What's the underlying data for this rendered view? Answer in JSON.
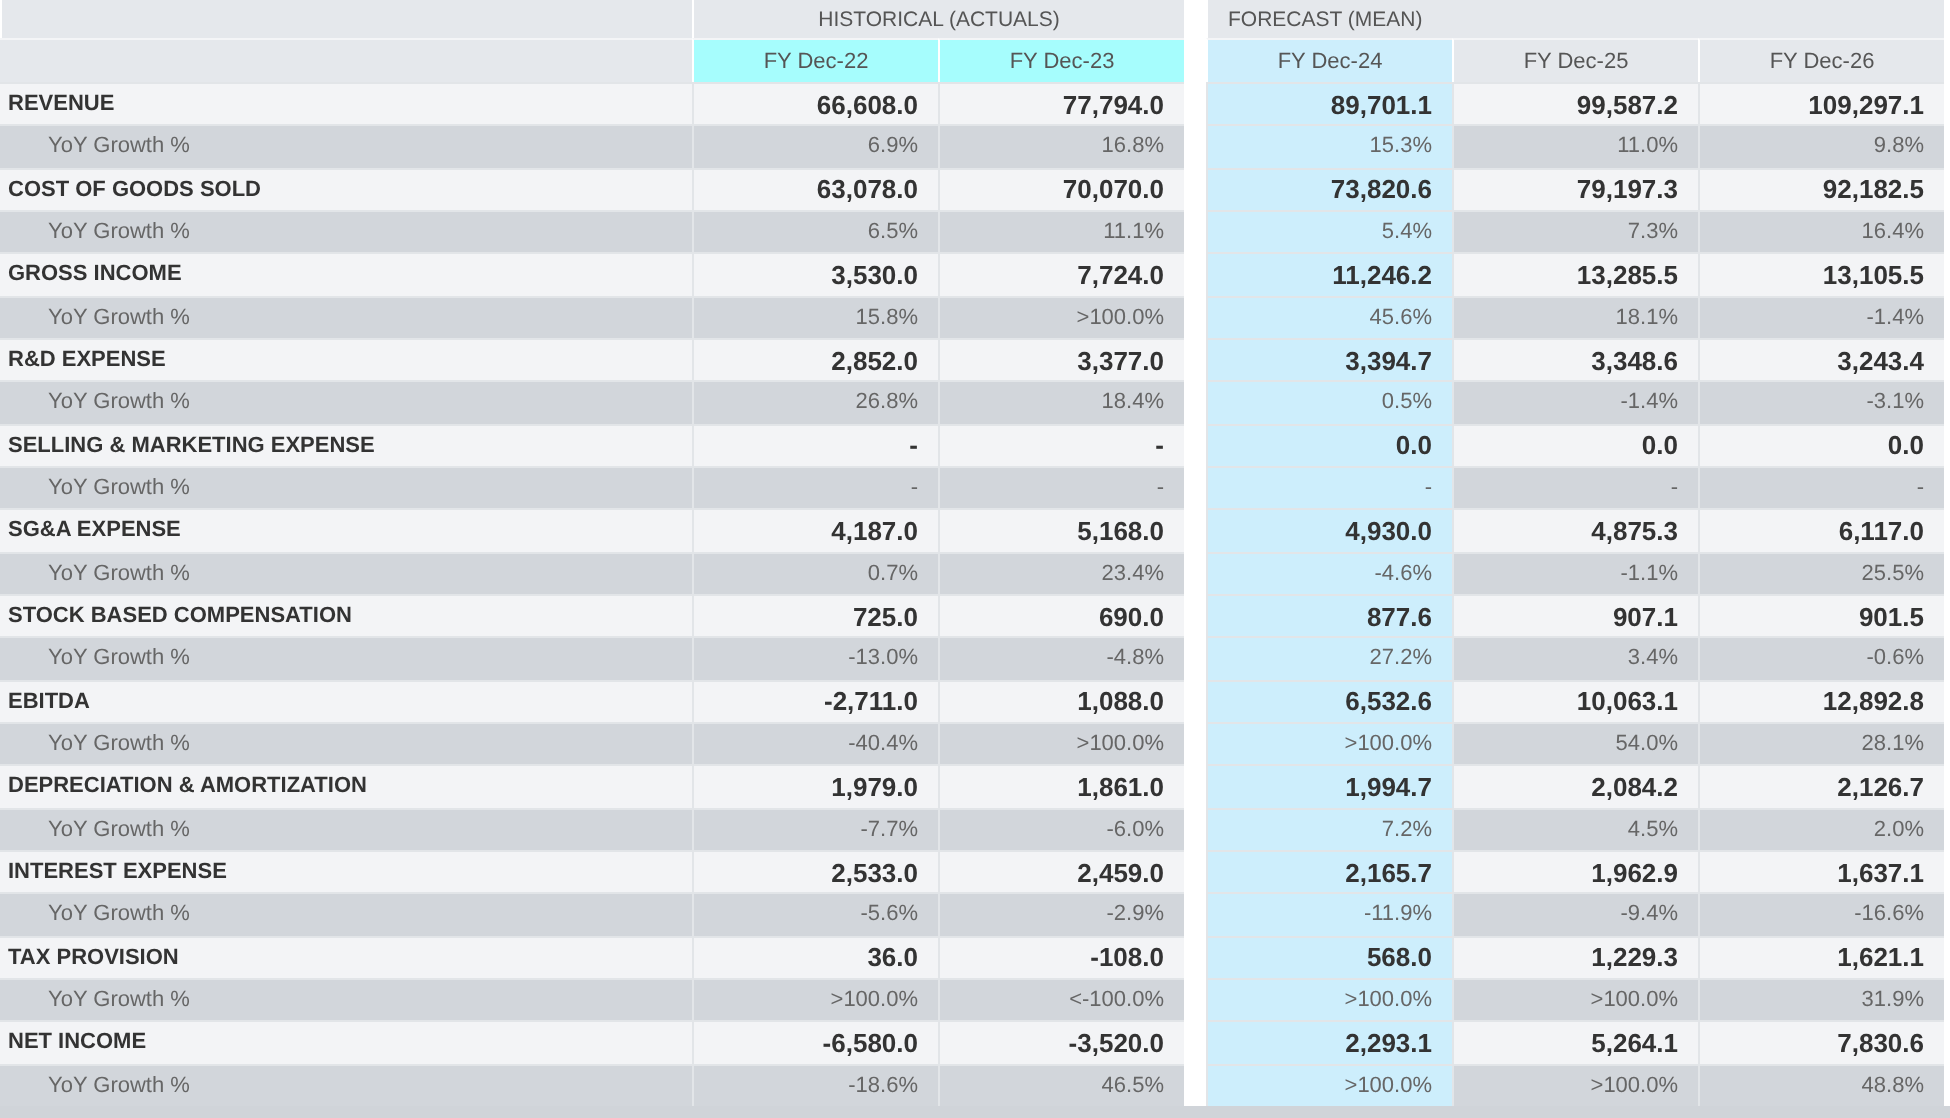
{
  "groups": [
    {
      "label": "HISTORICAL (ACTUALS)",
      "columns": [
        {
          "label": "FY Dec-22",
          "highlighted": true,
          "selected": false
        },
        {
          "label": "FY Dec-23",
          "highlighted": true,
          "selected": false
        }
      ]
    },
    {
      "label": "FORECAST (MEAN)",
      "columns": [
        {
          "label": "FY Dec-24",
          "highlighted": false,
          "selected": true
        },
        {
          "label": "FY Dec-25",
          "highlighted": false,
          "selected": false
        },
        {
          "label": "FY Dec-26",
          "highlighted": false,
          "selected": false
        }
      ]
    }
  ],
  "rows": [
    {
      "kind": "metric",
      "label": "REVENUE",
      "values": [
        "66,608.0",
        "77,794.0",
        "89,701.1",
        "99,587.2",
        "109,297.1"
      ]
    },
    {
      "kind": "growth",
      "label": "YoY Growth %",
      "values": [
        "6.9%",
        "16.8%",
        "15.3%",
        "11.0%",
        "9.8%"
      ]
    },
    {
      "kind": "metric",
      "label": "COST OF GOODS SOLD",
      "values": [
        "63,078.0",
        "70,070.0",
        "73,820.6",
        "79,197.3",
        "92,182.5"
      ]
    },
    {
      "kind": "growth",
      "label": "YoY Growth %",
      "values": [
        "6.5%",
        "11.1%",
        "5.4%",
        "7.3%",
        "16.4%"
      ]
    },
    {
      "kind": "metric",
      "label": "GROSS INCOME",
      "values": [
        "3,530.0",
        "7,724.0",
        "11,246.2",
        "13,285.5",
        "13,105.5"
      ]
    },
    {
      "kind": "growth",
      "label": "YoY Growth %",
      "values": [
        "15.8%",
        ">100.0%",
        "45.6%",
        "18.1%",
        "-1.4%"
      ]
    },
    {
      "kind": "metric",
      "label": "R&D EXPENSE",
      "values": [
        "2,852.0",
        "3,377.0",
        "3,394.7",
        "3,348.6",
        "3,243.4"
      ]
    },
    {
      "kind": "growth",
      "label": "YoY Growth %",
      "values": [
        "26.8%",
        "18.4%",
        "0.5%",
        "-1.4%",
        "-3.1%"
      ]
    },
    {
      "kind": "metric",
      "label": "SELLING & MARKETING EXPENSE",
      "values": [
        "-",
        "-",
        "0.0",
        "0.0",
        "0.0"
      ]
    },
    {
      "kind": "growth",
      "label": "YoY Growth %",
      "values": [
        "-",
        "-",
        "-",
        "-",
        "-"
      ]
    },
    {
      "kind": "metric",
      "label": "SG&A EXPENSE",
      "values": [
        "4,187.0",
        "5,168.0",
        "4,930.0",
        "4,875.3",
        "6,117.0"
      ]
    },
    {
      "kind": "growth",
      "label": "YoY Growth %",
      "values": [
        "0.7%",
        "23.4%",
        "-4.6%",
        "-1.1%",
        "25.5%"
      ]
    },
    {
      "kind": "metric",
      "label": "STOCK BASED COMPENSATION",
      "values": [
        "725.0",
        "690.0",
        "877.6",
        "907.1",
        "901.5"
      ]
    },
    {
      "kind": "growth",
      "label": "YoY Growth %",
      "values": [
        "-13.0%",
        "-4.8%",
        "27.2%",
        "3.4%",
        "-0.6%"
      ]
    },
    {
      "kind": "metric",
      "label": "EBITDA",
      "values": [
        "-2,711.0",
        "1,088.0",
        "6,532.6",
        "10,063.1",
        "12,892.8"
      ]
    },
    {
      "kind": "growth",
      "label": "YoY Growth %",
      "values": [
        "-40.4%",
        ">100.0%",
        ">100.0%",
        "54.0%",
        "28.1%"
      ]
    },
    {
      "kind": "metric",
      "label": "DEPRECIATION & AMORTIZATION",
      "values": [
        "1,979.0",
        "1,861.0",
        "1,994.7",
        "2,084.2",
        "2,126.7"
      ]
    },
    {
      "kind": "growth",
      "label": "YoY Growth %",
      "values": [
        "-7.7%",
        "-6.0%",
        "7.2%",
        "4.5%",
        "2.0%"
      ]
    },
    {
      "kind": "metric",
      "label": "INTEREST EXPENSE",
      "values": [
        "2,533.0",
        "2,459.0",
        "2,165.7",
        "1,962.9",
        "1,637.1"
      ]
    },
    {
      "kind": "growth",
      "label": "YoY Growth %",
      "values": [
        "-5.6%",
        "-2.9%",
        "-11.9%",
        "-9.4%",
        "-16.6%"
      ]
    },
    {
      "kind": "metric",
      "label": "TAX PROVISION",
      "values": [
        "36.0",
        "-108.0",
        "568.0",
        "1,229.3",
        "1,621.1"
      ]
    },
    {
      "kind": "growth",
      "label": "YoY Growth %",
      "values": [
        ">100.0%",
        "<-100.0%",
        ">100.0%",
        ">100.0%",
        "31.9%"
      ]
    },
    {
      "kind": "metric",
      "label": "NET INCOME",
      "values": [
        "-6,580.0",
        "-3,520.0",
        "2,293.1",
        "5,264.1",
        "7,830.6"
      ]
    },
    {
      "kind": "growth",
      "label": "YoY Growth %",
      "values": [
        "-18.6%",
        "46.5%",
        ">100.0%",
        ">100.0%",
        "48.8%"
      ]
    }
  ]
}
